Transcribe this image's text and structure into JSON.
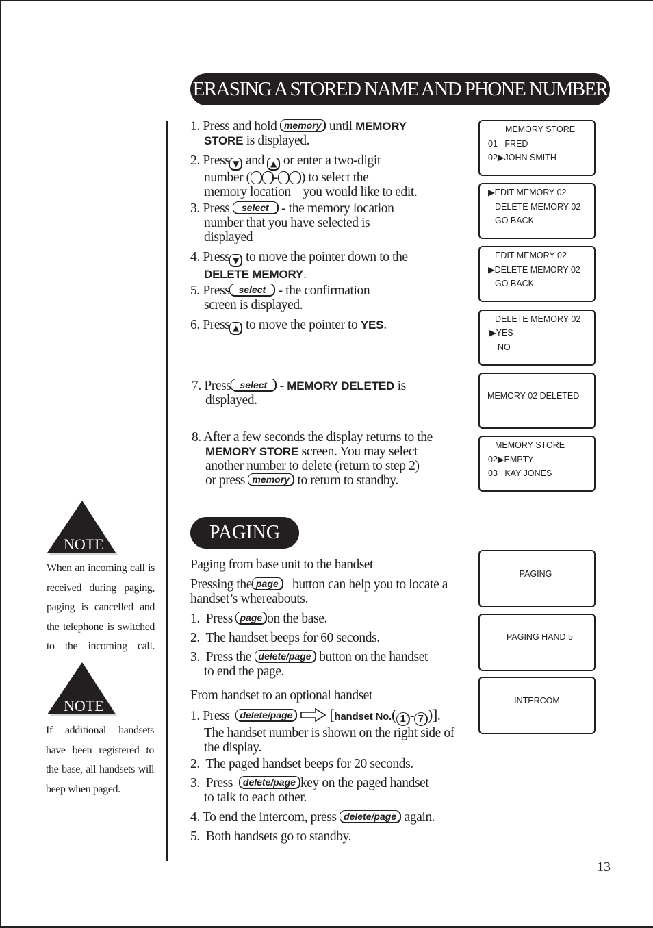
{
  "page": {
    "number": "13"
  },
  "erase_section": {
    "title": "ERASING A STORED NAME AND PHONE NUMBER",
    "steps": [
      {
        "num": "1.",
        "parts": [
          "Press and hold",
          "memory",
          "until",
          "MEMORY",
          "STORE",
          "is displayed."
        ]
      },
      {
        "num": "2.",
        "parts": [
          "Press",
          "and",
          "or enter a two-digit",
          "number (",
          ") to select the",
          "memory location",
          "you would like to edit."
        ]
      },
      {
        "num": "3.",
        "parts": [
          "Press",
          "select",
          "- the memory location",
          "number that you have selected is",
          "displayed"
        ]
      },
      {
        "num": "4.",
        "parts": [
          "Press",
          "to move the pointer down to the",
          "DELETE MEMORY",
          "."
        ]
      },
      {
        "num": "5.",
        "parts": [
          "Press",
          "select",
          "- the confirmation",
          "screen is displayed."
        ]
      },
      {
        "num": "6.",
        "parts": [
          "Press",
          "to move the pointer to",
          "YES",
          "."
        ]
      },
      {
        "num": "7.",
        "parts": [
          "Press",
          "select",
          "-",
          "MEMORY DELETED",
          "is",
          "displayed."
        ]
      },
      {
        "num": "8.",
        "parts": [
          "After a few seconds the display returns to the",
          "MEMORY STORE",
          "screen. You may select",
          "another number to delete (return to step 2)",
          "or press",
          "memory",
          "to return to standby."
        ]
      }
    ],
    "icons": {
      "down": "▼",
      "up": "▲"
    }
  },
  "lcd_screens": [
    {
      "lines": [
        "MEMORY STORE",
        "01   FRED",
        "02▶JOHN SMITH"
      ]
    },
    {
      "lines": [
        "▶EDIT MEMORY 02",
        "DELETE MEMORY 02",
        "GO BACK"
      ]
    },
    {
      "lines": [
        "EDIT MEMORY 02",
        "▶DELETE MEMORY 02",
        "GO BACK"
      ]
    },
    {
      "lines": [
        "DELETE MEMORY 02",
        "▶YES",
        "NO"
      ]
    },
    {
      "lines": [
        "MEMORY 02 DELETED"
      ]
    },
    {
      "lines": [
        "MEMORY STORE",
        "02▶EMPTY",
        "03   KAY JONES"
      ]
    },
    {
      "lines": [
        "PAGING"
      ]
    },
    {
      "lines": [
        "PAGING HAND 5"
      ]
    },
    {
      "lines": [
        "INTERCOM"
      ]
    }
  ],
  "paging_section": {
    "title": "PAGING",
    "base_subhead": "Paging from base unit to the handset",
    "intro": [
      "Pressing the",
      "page",
      "button can help you to locate a",
      "handset’s whereabouts."
    ],
    "base_steps": [
      {
        "num": "1.",
        "parts": [
          "Press",
          "page",
          "on the base."
        ]
      },
      {
        "num": "2.",
        "parts": [
          "The handset beeps for 60 seconds."
        ]
      },
      {
        "num": "3.",
        "parts": [
          "Press the",
          "delete/page",
          "button on the handset",
          "to end the page."
        ]
      }
    ],
    "handset_subhead": "From handset to an optional handset",
    "handset_steps": [
      {
        "num": "1.",
        "parts": [
          "Press",
          "delete/page",
          "[",
          "handset No.",
          "(",
          "1",
          "-",
          "7",
          ")",
          "]",
          ".",
          "The handset number is shown on the right side of",
          "the display."
        ]
      },
      {
        "num": "2.",
        "parts": [
          "The paged handset beeps for 20 seconds."
        ]
      },
      {
        "num": "3.",
        "parts": [
          "Press",
          "delete/page",
          "key on the paged handset",
          "to talk to each other."
        ]
      },
      {
        "num": "4.",
        "parts": [
          "To end the intercom, press",
          "delete/page",
          "again."
        ]
      },
      {
        "num": "5.",
        "parts": [
          "Both handsets go to standby."
        ]
      }
    ]
  },
  "notes": [
    {
      "label": "NOTE",
      "text": "When an incoming call is received during paging, paging is cancelled and the telephone is switched to the incoming call."
    },
    {
      "label": "NOTE",
      "text": "If additional handsets have been registered to the base, all handsets will beep when paged."
    }
  ]
}
